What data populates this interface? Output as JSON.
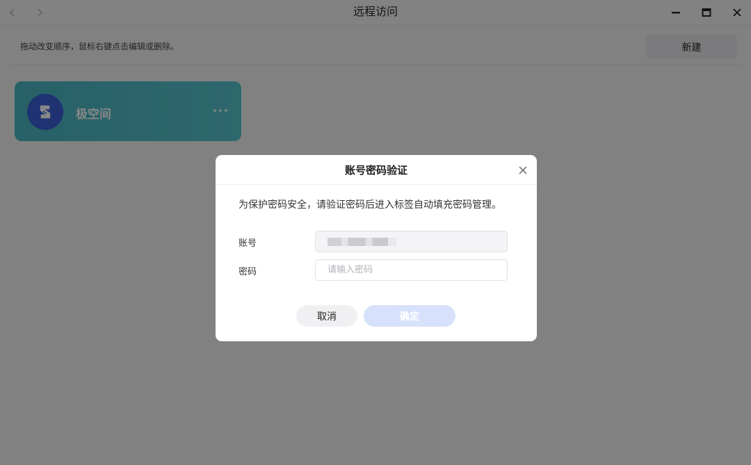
{
  "window": {
    "title": "远程访问"
  },
  "toolbar": {
    "hint": "拖动改变顺序，鼠标右键点击编辑或删除。",
    "new_label": "新建"
  },
  "cards": [
    {
      "label": "极空间"
    }
  ],
  "dialog": {
    "title": "账号密码验证",
    "description": "为保护密码安全，请验证密码后进入标签自动填充密码管理。",
    "account_label": "账号",
    "password_label": "密码",
    "password_placeholder": "请输入密码",
    "cancel_label": "取消",
    "confirm_label": "确定"
  },
  "colors": {
    "card_accent": "#4bb8c4",
    "logo_blue": "#3b5fd8",
    "confirm_disabled": "#d7e1fb"
  }
}
